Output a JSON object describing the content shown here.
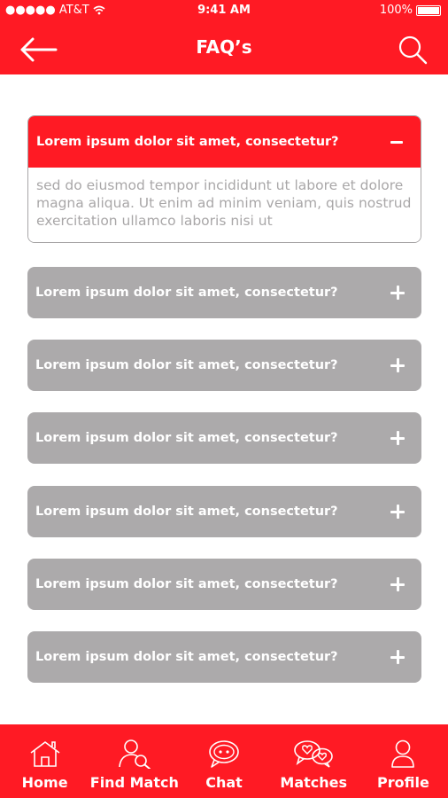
{
  "status_bar": {
    "carrier": "●●●●● AT&T",
    "time": "9:41 AM",
    "battery": "100%"
  },
  "header": {
    "title": "FAQ’s",
    "back_icon": "arrow-left-icon",
    "search_icon": "search-icon"
  },
  "faqs": [
    {
      "question": "Lorem ipsum dolor sit amet, consectetur?",
      "answer": "sed do eiusmod tempor incididunt ut labore et dolore magna aliqua. Ut enim ad minim veniam, quis nostrud exercitation ullamco laboris nisi ut",
      "expanded": true
    },
    {
      "question": "Lorem ipsum dolor sit amet, consectetur?",
      "expanded": false
    },
    {
      "question": "Lorem ipsum dolor sit amet, consectetur?",
      "expanded": false
    },
    {
      "question": "Lorem ipsum dolor sit amet, consectetur?",
      "expanded": false
    },
    {
      "question": "Lorem ipsum dolor sit amet, consectetur?",
      "expanded": false
    },
    {
      "question": "Lorem ipsum dolor sit amet, consectetur?",
      "expanded": false
    },
    {
      "question": "Lorem ipsum dolor sit amet, consectetur?",
      "expanded": false
    }
  ],
  "bottom_nav": [
    {
      "label": "Home",
      "icon": "home-icon"
    },
    {
      "label": "Find Match",
      "icon": "find-match-icon"
    },
    {
      "label": "Chat",
      "icon": "chat-icon"
    },
    {
      "label": "Matches",
      "icon": "matches-icon"
    },
    {
      "label": "Profile",
      "icon": "profile-icon"
    }
  ],
  "colors": {
    "accent": "#ff1a24",
    "collapsed": "#acaaab",
    "answer_text": "#a9a7a8"
  }
}
